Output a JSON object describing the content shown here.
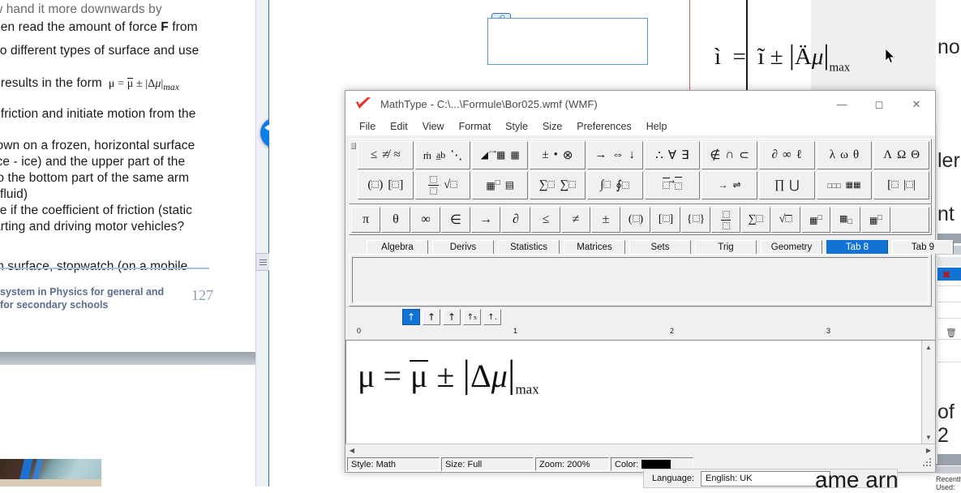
{
  "background_document": {
    "left_lines": [
      "hen read the amount of force F from",
      "vo different types of surface and use",
      "t results in the form",
      ": friction and initiate motion from the",
      "lown on a frozen, horizontal surface",
      "ice - ice) and the upper part of the",
      "to the bottom part of the same arm",
      "l fluid)",
      "ce if the coefficient of friction (static",
      "arting and driving motor vehicles?",
      "m surface, stopwatch (on a mobile"
    ],
    "inline_formula": "μ = μ̄ ± |Δμ|max",
    "footer_text": "system in Physics for general and for secondary schools",
    "page_number": "127",
    "right_fragments": [
      "no",
      "ler",
      "nt",
      "of 2",
      "ame arn"
    ],
    "recently_used_label": "Recently Used:"
  },
  "ole_object": {
    "equation_garbled": "ì = ĩ ± |Äμ|max",
    "handle_icon": "link-icon"
  },
  "mathtype": {
    "title": "MathType - C:\\...\\Formule\\Bor025.wmf (WMF)",
    "logo_icon": "mathtype-checkmark-logo",
    "window_buttons": [
      {
        "name": "minimize",
        "glyph": "—"
      },
      {
        "name": "maximize",
        "glyph": "☐"
      },
      {
        "name": "close",
        "glyph": "✕"
      }
    ],
    "menu": [
      "File",
      "Edit",
      "View",
      "Format",
      "Style",
      "Size",
      "Preferences",
      "Help"
    ],
    "toolbar_rows": [
      [
        {
          "name": "relations-palette",
          "glyphs": "≤ ≮ ≈"
        },
        {
          "name": "spaces-dots-palette",
          "glyphs": "∴ a̲b ⋱"
        },
        {
          "name": "embellishments-palette",
          "glyphs": "◢´ ⃗▦ ▦"
        },
        {
          "name": "operators-palette",
          "glyphs": "± • ⊗"
        },
        {
          "name": "arrows-palette",
          "glyphs": "→ ⇔ ↓"
        },
        {
          "name": "logic-palette",
          "glyphs": "∴ ∀ ∃"
        },
        {
          "name": "set-theory-palette",
          "glyphs": "∉ ∩ ⊂"
        },
        {
          "name": "variables-palette",
          "glyphs": "∂ ∞ ℓ"
        },
        {
          "name": "greek-lowercase-palette",
          "glyphs": "λ ω θ"
        },
        {
          "name": "greek-uppercase-palette",
          "glyphs": "Λ Ω Θ"
        }
      ],
      [
        {
          "name": "fences-palette",
          "glyphs": "(□) [□]"
        },
        {
          "name": "fraction-radical-palette",
          "glyphs": "□/□ √□"
        },
        {
          "name": "subscript-superscript-palette",
          "glyphs": "▦· □̲"
        },
        {
          "name": "summation-palette",
          "glyphs": "∑□ ∑□"
        },
        {
          "name": "integral-palette",
          "glyphs": "∫□ ∮□"
        },
        {
          "name": "underbar-overbar-palette",
          "glyphs": "□̅ □⃗"
        },
        {
          "name": "labeled-arrow-palette",
          "glyphs": "→ ⇌"
        },
        {
          "name": "products-set-theory-palette",
          "glyphs": "∏ ⋃"
        },
        {
          "name": "matrix-templates-palette",
          "glyphs": "□□□ ▒"
        },
        {
          "name": "matrix-fences-palette",
          "glyphs": "[□ |□|"
        }
      ]
    ],
    "symbol_row": [
      "π",
      "θ",
      "∞",
      "∈",
      "→",
      "∂",
      "≤",
      "≠",
      "±",
      "(□)",
      "[□]",
      "{□}",
      "□/□",
      "∑□",
      "√□",
      "▦□",
      "▦□",
      "▦□"
    ],
    "tabs": [
      {
        "label": "Algebra",
        "active": false
      },
      {
        "label": "Derivs",
        "active": false
      },
      {
        "label": "Statistics",
        "active": false
      },
      {
        "label": "Matrices",
        "active": false
      },
      {
        "label": "Sets",
        "active": false
      },
      {
        "label": "Trig",
        "active": false
      },
      {
        "label": "Geometry",
        "active": false
      },
      {
        "label": "Tab 8",
        "active": true
      },
      {
        "label": "Tab 9",
        "active": false
      }
    ],
    "align_buttons": [
      {
        "name": "align-left",
        "glyph": "↑",
        "active": true
      },
      {
        "name": "align-center",
        "glyph": "↑",
        "active": false
      },
      {
        "name": "align-right",
        "glyph": "↑",
        "active": false
      },
      {
        "name": "align-at-equals",
        "glyph": "↑",
        "active": false
      },
      {
        "name": "align-at-decimal",
        "glyph": "↑",
        "active": false
      }
    ],
    "ruler_labels": [
      "0",
      "1",
      "2",
      "3"
    ],
    "equation": {
      "lhs": "μ",
      "equals": "=",
      "mean": "μ",
      "pm": "±",
      "abs_open": "|",
      "delta": "Δμ",
      "abs_close": "|",
      "subscript": "max"
    },
    "status": {
      "style": "Style: Math",
      "size": "Size: Full",
      "zoom": "Zoom: 200%",
      "color_label": "Color:",
      "color_value": "#000000"
    }
  },
  "language_bar": {
    "label": "Language:",
    "value": "English: UK",
    "arrow_icon": "chevron-down-icon"
  },
  "taskbar_icons": {
    "dropbox": "dropbox-icon",
    "menu_handle": "hamburger-handle-icon"
  },
  "colors": {
    "accent_blue": "#1273d6",
    "window_chrome": "#f0f0f0",
    "selection_blue": "#5b9bd5",
    "footer_blue": "#5b6e8c",
    "dropbox_blue": "#0d7ee5"
  }
}
